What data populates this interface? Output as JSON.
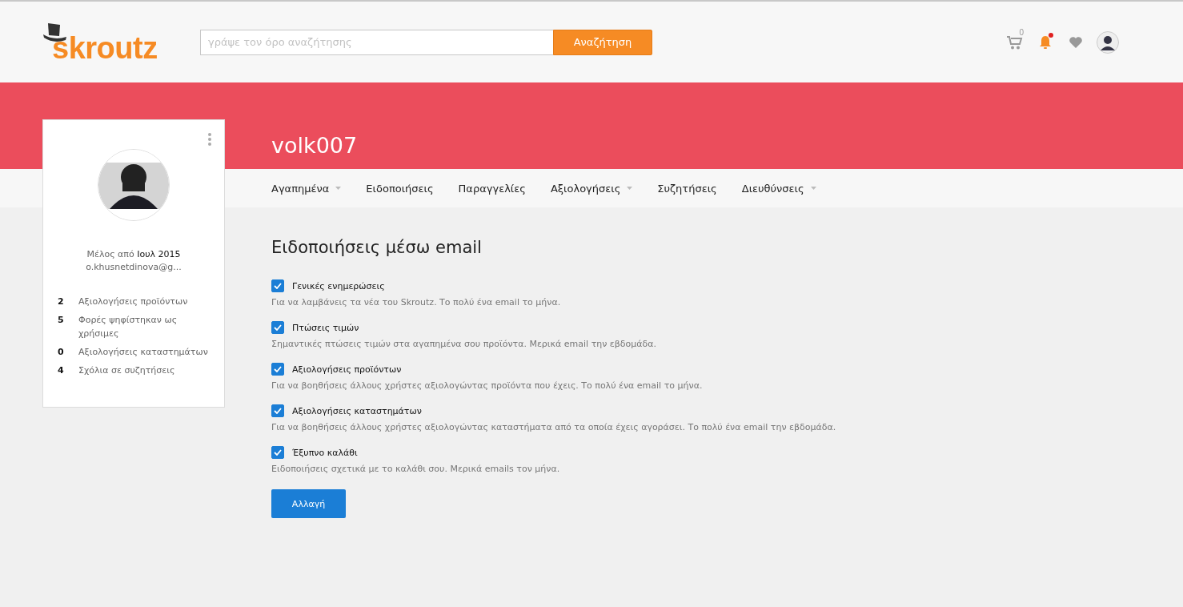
{
  "header": {
    "logo": "skroutz",
    "search": {
      "placeholder": "γράψε τον όρο αναζήτησης",
      "button": "Αναζήτηση"
    },
    "cart_count": "0",
    "notification_unread": true
  },
  "profile": {
    "username": "volk007",
    "member_since_label": "Μέλος από",
    "member_since": "Ιουλ 2015",
    "email": "o.khusnetdinova@g...",
    "stats": [
      {
        "count": "2",
        "label": "Αξιολογήσεις προϊόντων"
      },
      {
        "count": "5",
        "label": "Φορές ψηφίστηκαν ως χρήσιμες"
      },
      {
        "count": "0",
        "label": "Αξιολογήσεις καταστημάτων"
      },
      {
        "count": "4",
        "label": "Σχόλια σε συζητήσεις"
      }
    ]
  },
  "nav": [
    {
      "label": "Αγαπημένα",
      "dropdown": true
    },
    {
      "label": "Ειδοποιήσεις",
      "dropdown": false
    },
    {
      "label": "Παραγγελίες",
      "dropdown": false
    },
    {
      "label": "Αξιολογήσεις",
      "dropdown": true
    },
    {
      "label": "Συζητήσεις",
      "dropdown": false
    },
    {
      "label": "Διευθύνσεις",
      "dropdown": true
    }
  ],
  "settings": {
    "title": "Ειδοποιήσεις μέσω email",
    "options": [
      {
        "label": "Γενικές ενημερώσεις",
        "description": "Για να λαμβάνεις τα νέα του Skroutz. Το πολύ ένα email το μήνα.",
        "checked": true
      },
      {
        "label": "Πτώσεις τιμών",
        "description": "Σημαντικές πτώσεις τιμών στα αγαπημένα σου προϊόντα. Μερικά email την εβδομάδα.",
        "checked": true
      },
      {
        "label": "Αξιολογήσεις προϊόντων",
        "description": "Για να βοηθήσεις άλλους χρήστες αξιολογώντας προϊόντα που έχεις. Το πολύ ένα email το μήνα.",
        "checked": true
      },
      {
        "label": "Αξιολογήσεις καταστημάτων",
        "description": "Για να βοηθήσεις άλλους χρήστες αξιολογώντας καταστήματα από τα οποία έχεις αγοράσει. Το πολύ ένα email την εβδομάδα.",
        "checked": true
      },
      {
        "label": "Έξυπνο καλάθι",
        "description": "Ειδοποιήσεις σχετικά με το καλάθι σου. Μερικά emails τον μήνα.",
        "checked": true
      }
    ],
    "submit": "Αλλαγή"
  }
}
